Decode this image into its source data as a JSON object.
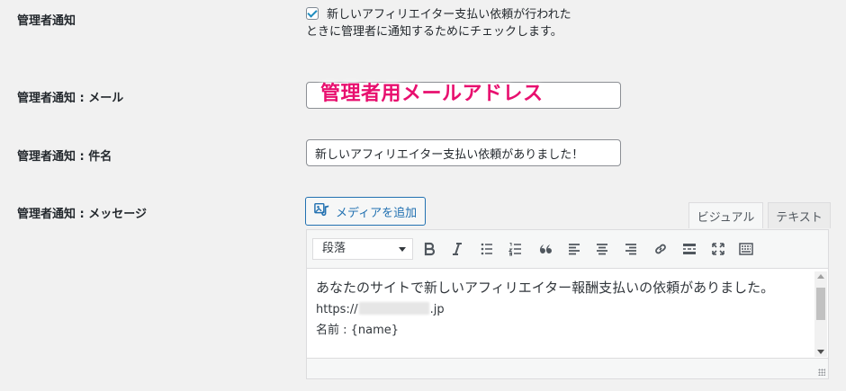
{
  "rows": {
    "notify": {
      "label": "管理者通知",
      "checkbox_checked": true,
      "checkbox_text": "新しいアフィリエイター支払い依頼が行われたときに管理者に通知するためにチェックします。"
    },
    "email": {
      "label": "管理者通知 : メール",
      "value": "",
      "annotation": "管理者用メールアドレス"
    },
    "subject": {
      "label": "管理者通知 : 件名",
      "value": "新しいアフィリエイター支払い依頼がありました！"
    },
    "message": {
      "label": "管理者通知 : メッセージ"
    }
  },
  "editor": {
    "media_button_label": "メディアを追加",
    "tabs": {
      "visual": "ビジュアル",
      "text": "テキスト"
    },
    "format_select": "段落",
    "toolbar_icons": [
      "bold-icon",
      "italic-icon",
      "bullet-list-icon",
      "numbered-list-icon",
      "blockquote-icon",
      "align-left-icon",
      "align-center-icon",
      "align-right-icon",
      "link-icon",
      "read-more-icon",
      "fullscreen-icon",
      "toolbar-toggle-icon"
    ],
    "content": {
      "line1": "あなたのサイトで新しいアフィリエイター報酬支払いの依頼がありました。",
      "line2_prefix": "https://",
      "line2_suffix": ".jp",
      "line3": "名前 : {name}"
    }
  },
  "colors": {
    "accent": "#2271b1",
    "annotation": "#e8106f",
    "checkmark": "#1e8cbe"
  }
}
